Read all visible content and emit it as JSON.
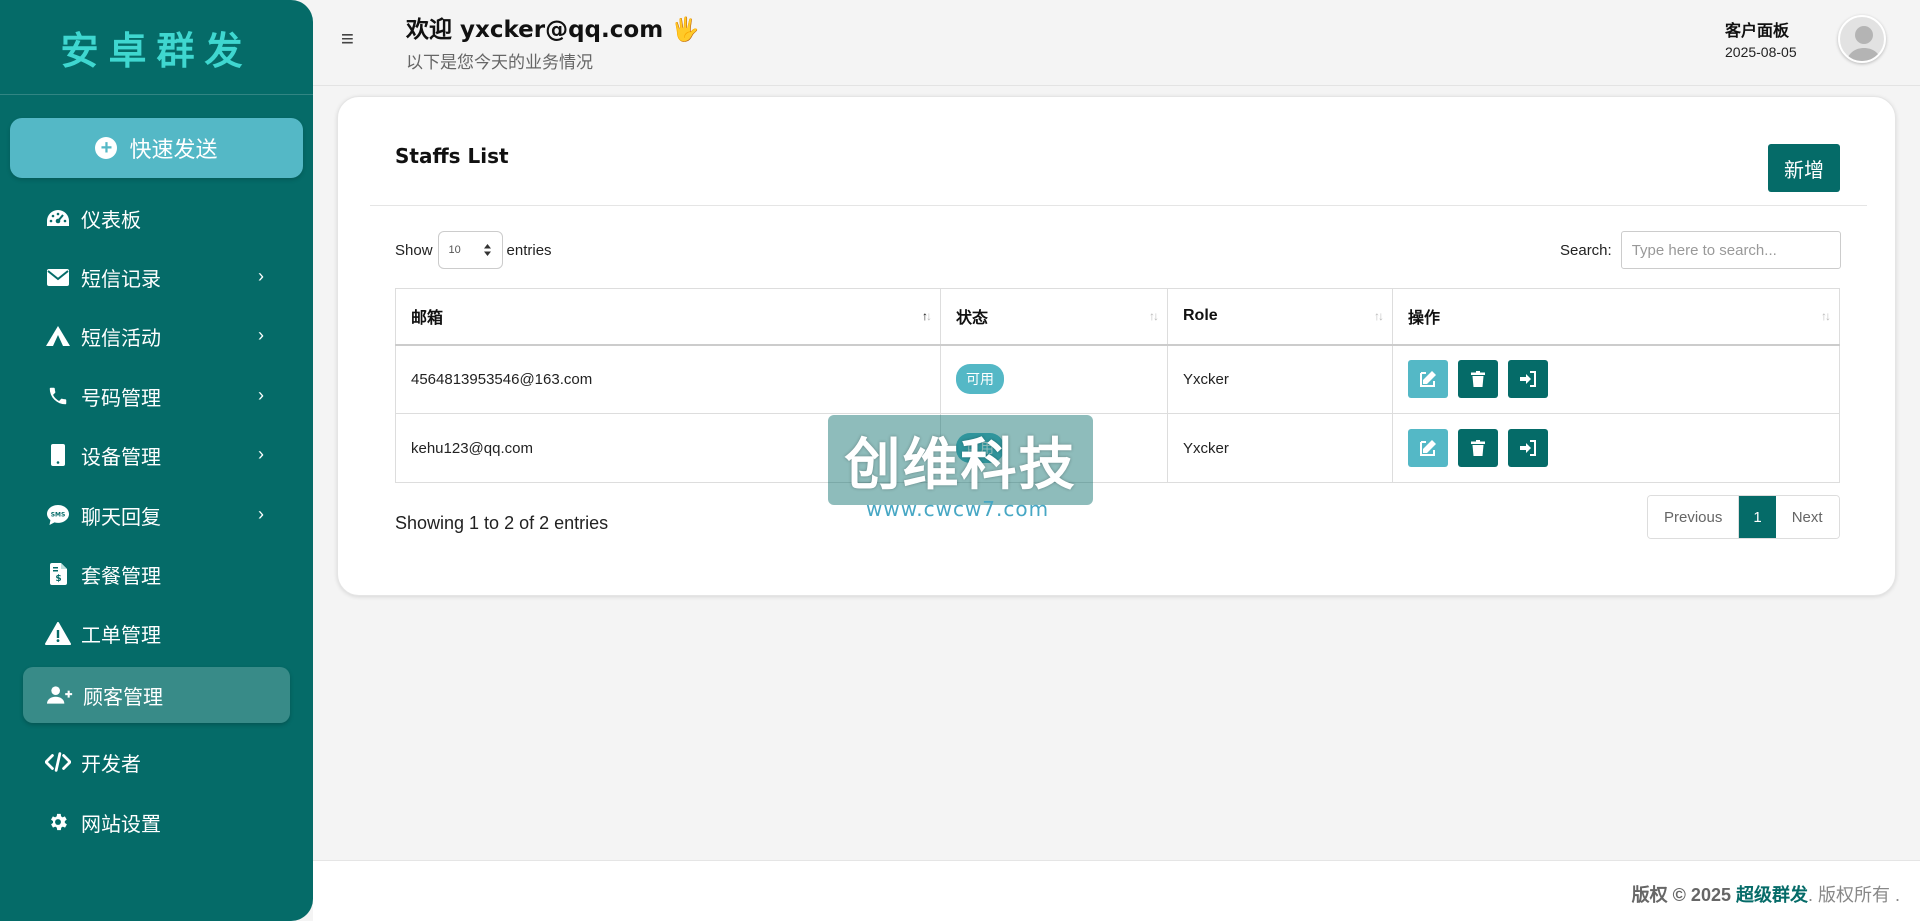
{
  "sidebar": {
    "brand": "安卓群发",
    "quick_send": "快速发送",
    "items": [
      {
        "label": "仪表板",
        "icon": "dashboard-gauge-icon",
        "chevron": false
      },
      {
        "label": "短信记录",
        "icon": "envelope-icon",
        "chevron": true
      },
      {
        "label": "短信活动",
        "icon": "tent-icon",
        "chevron": true
      },
      {
        "label": "号码管理",
        "icon": "phone-icon",
        "chevron": true
      },
      {
        "label": "设备管理",
        "icon": "mobile-icon",
        "chevron": true
      },
      {
        "label": "聊天回复",
        "icon": "sms-bubble-icon",
        "chevron": true
      },
      {
        "label": "套餐管理",
        "icon": "invoice-dollar-icon",
        "chevron": false
      },
      {
        "label": "工单管理",
        "icon": "warning-triangle-icon",
        "chevron": false
      },
      {
        "label": "顾客管理",
        "icon": "user-plus-icon",
        "chevron": false,
        "active": true
      },
      {
        "label": "开发者",
        "icon": "code-icon",
        "chevron": false
      },
      {
        "label": "网站设置",
        "icon": "gear-icon",
        "chevron": false
      }
    ]
  },
  "header": {
    "welcome": "欢迎 yxcker@qq.com 🖐️",
    "subtitle": "以下是您今天的业务情况",
    "client_panel": "客户面板",
    "date": "2025-08-05"
  },
  "card": {
    "title": "Staffs List",
    "add_button": "新增",
    "show_label": "Show",
    "entries_label": "entries",
    "page_size": "10",
    "search_label": "Search:",
    "search_placeholder": "Type here to search...",
    "columns": [
      "邮箱",
      "状态",
      "Role",
      "操作"
    ],
    "rows": [
      {
        "email": "4564813953546@163.com",
        "status": "可用",
        "role": "Yxcker"
      },
      {
        "email": "kehu123@qq.com",
        "status": "可用",
        "role": "Yxcker"
      }
    ],
    "showing": "Showing 1 to 2 of 2 entries",
    "pager": {
      "previous": "Previous",
      "current": "1",
      "next": "Next"
    }
  },
  "watermark": {
    "text": "创维科技",
    "url": "www.cwcw7.com"
  },
  "footer": {
    "prefix": "版权 © 2025 ",
    "brand": "超级群发",
    "suffix": ". 版权所有 ."
  },
  "colors": {
    "primary": "#056b68",
    "accent": "#54b8c6",
    "brand_text": "#3fd7d0"
  }
}
